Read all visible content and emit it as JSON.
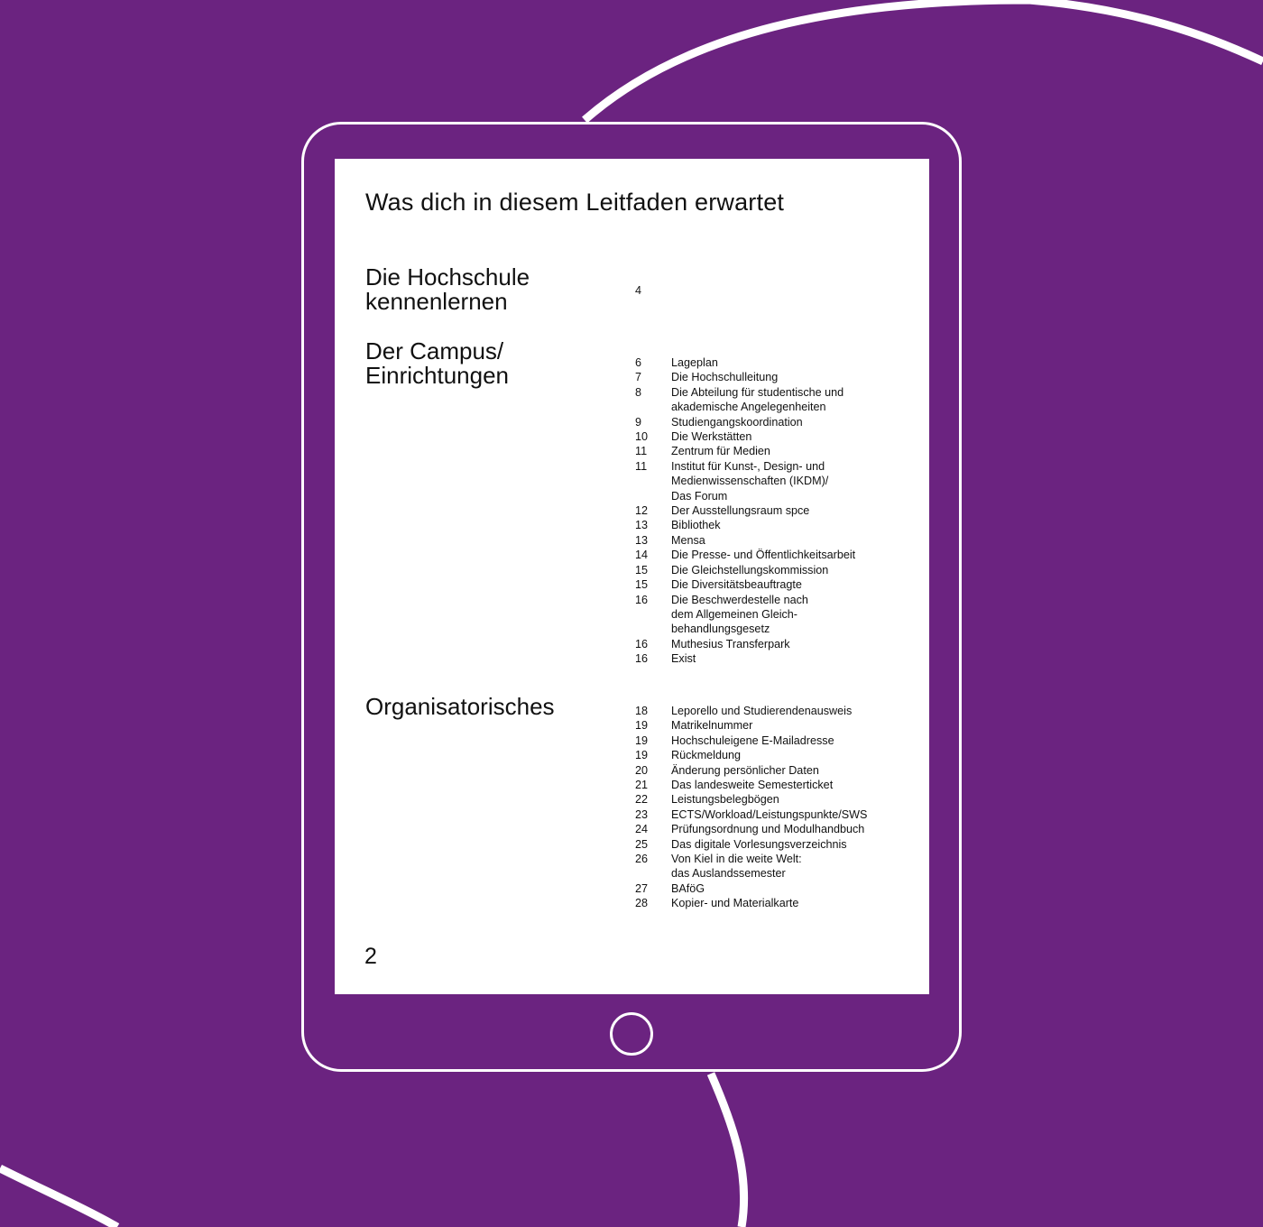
{
  "colors": {
    "background": "#6b2380",
    "outline": "#ffffff",
    "page": "#ffffff",
    "text": "#111111"
  },
  "device": {
    "type": "tablet",
    "home_button_icon": "circle-home-button-icon"
  },
  "document": {
    "title": "Was dich in diesem Leitfaden erwartet",
    "page_number": "2",
    "sections": [
      {
        "title_lines": [
          "Die Hochschule",
          "kennenlernen"
        ],
        "entries": [
          {
            "page": "4",
            "lines": [
              ""
            ]
          }
        ]
      },
      {
        "title_lines": [
          "Der Campus/",
          "Einrichtungen"
        ],
        "entries": [
          {
            "page": "6",
            "lines": [
              "Lageplan"
            ]
          },
          {
            "page": "7",
            "lines": [
              "Die Hochschulleitung"
            ]
          },
          {
            "page": "8",
            "lines": [
              "Die Abteilung für studentische und",
              "akademische Angelegenheiten"
            ]
          },
          {
            "page": "9",
            "lines": [
              "Studiengangskoordination"
            ]
          },
          {
            "page": "10",
            "lines": [
              "Die Werkstätten"
            ]
          },
          {
            "page": "11",
            "lines": [
              "Zentrum für Medien"
            ]
          },
          {
            "page": "11",
            "lines": [
              "Institut für Kunst-, Design- und",
              "Medienwissenschaften (IKDM)/",
              "Das Forum"
            ]
          },
          {
            "page": "12",
            "lines": [
              "Der Ausstellungsraum spce"
            ]
          },
          {
            "page": "13",
            "lines": [
              "Bibliothek"
            ]
          },
          {
            "page": "13",
            "lines": [
              "Mensa"
            ]
          },
          {
            "page": "14",
            "lines": [
              "Die Presse- und Öffentlichkeitsarbeit"
            ]
          },
          {
            "page": "15",
            "lines": [
              "Die Gleichstellungskommission"
            ]
          },
          {
            "page": "15",
            "lines": [
              "Die Diversitätsbeauftragte"
            ]
          },
          {
            "page": "16",
            "lines": [
              "Die Beschwerdestelle nach",
              "dem Allgemeinen Gleich-",
              "behandlungsgesetz"
            ]
          },
          {
            "page": "16",
            "lines": [
              "Muthesius Transferpark"
            ]
          },
          {
            "page": "16",
            "lines": [
              "Exist"
            ]
          }
        ]
      },
      {
        "title_lines": [
          "Organisatorisches"
        ],
        "entries": [
          {
            "page": "18",
            "lines": [
              "Leporello und Studierendenausweis"
            ]
          },
          {
            "page": "19",
            "lines": [
              "Matrikelnummer"
            ]
          },
          {
            "page": "19",
            "lines": [
              "Hochschuleigene E-Mailadresse"
            ]
          },
          {
            "page": "19",
            "lines": [
              "Rückmeldung"
            ]
          },
          {
            "page": "20",
            "lines": [
              "Änderung persönlicher Daten"
            ]
          },
          {
            "page": "21",
            "lines": [
              "Das landesweite Semesterticket"
            ]
          },
          {
            "page": "22",
            "lines": [
              "Leistungsbelegbögen"
            ]
          },
          {
            "page": "23",
            "lines": [
              "ECTS/Workload/Leistungspunkte/SWS"
            ]
          },
          {
            "page": "24",
            "lines": [
              "Prüfungsordnung und Modulhandbuch"
            ]
          },
          {
            "page": "25",
            "lines": [
              "Das digitale Vorlesungsverzeichnis"
            ]
          },
          {
            "page": "26",
            "lines": [
              "Von Kiel in die weite Welt:",
              "das Auslandssemester"
            ]
          },
          {
            "page": "27",
            "lines": [
              "BAföG"
            ]
          },
          {
            "page": "28",
            "lines": [
              "Kopier- und Materialkarte"
            ]
          }
        ]
      }
    ]
  }
}
